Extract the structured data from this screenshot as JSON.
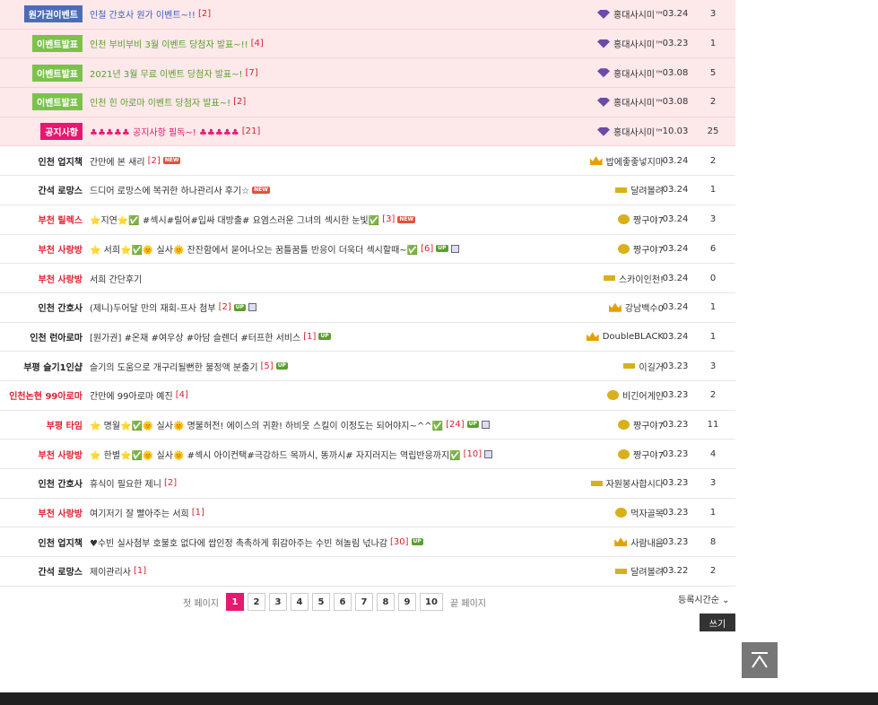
{
  "rows": [
    {
      "cat": "원가권이벤트",
      "badge": "#4d6cb8",
      "title": "인철 간호사 원가 이벤트~!!",
      "tcolor": "#3a62c5",
      "cmt": "[2]",
      "author": "홍대사시미™",
      "lvl": "gem",
      "date": "03.24",
      "hits": "3",
      "hl": true
    },
    {
      "cat": "이벤트발표",
      "badge": "#7cc24a",
      "title": "인천 부비부비 3월 이벤트 당첨자 발표~!!",
      "tcolor": "#5aa02c",
      "cmt": "[4]",
      "author": "홍대사시미™",
      "lvl": "gem",
      "date": "03.23",
      "hits": "1",
      "hl": true
    },
    {
      "cat": "이벤트발표",
      "badge": "#7cc24a",
      "title": "2021년 3월 무료 이벤트 당첨자 발표~!",
      "tcolor": "#5aa02c",
      "cmt": "[7]",
      "author": "홍대사시미™",
      "lvl": "gem",
      "date": "03.08",
      "hits": "5",
      "hl": true
    },
    {
      "cat": "이벤트발표",
      "badge": "#7cc24a",
      "title": "인천 힌 아로마 이벤트 당첨자 발표~!",
      "tcolor": "#5aa02c",
      "cmt": "[2]",
      "author": "홍대사시미™",
      "lvl": "gem",
      "date": "03.08",
      "hits": "2",
      "hl": true
    },
    {
      "cat": "공지사항",
      "badge": "#e6186f",
      "title": "♣♣♣♣♣ 공지사항 필독~! ♣♣♣♣♣",
      "tcolor": "#e6186f",
      "cmt": "[21]",
      "author": "홍대사시미™",
      "lvl": "gem",
      "date": "10.03",
      "hits": "25",
      "hl": true
    },
    {
      "cat": "인천 업지책",
      "ccolor": "#222",
      "title": "간만에 본 새리",
      "cmt": "[2]",
      "icons": [
        "new"
      ],
      "author": "밥에좋좋넣지마",
      "lvl": "crown",
      "date": "03.24",
      "hits": "2"
    },
    {
      "cat": "간석 로망스",
      "ccolor": "#222",
      "title": "드디어 로망스에 복귀한 하나관리사 후기☆",
      "cmt": "",
      "icons": [
        "new"
      ],
      "author": "달려볼려",
      "lvl": "bar",
      "date": "03.24",
      "hits": "1"
    },
    {
      "cat": "부천 릴렉스",
      "ccolor": "#d23",
      "title": "⭐지연⭐✅ #섹시#릴어#입싸 대방출# 요염스러운 그녀의 섹시한 눈빛✅",
      "cmt": "[3]",
      "icons": [
        "new"
      ],
      "author": "짱구야7",
      "lvl": "coin",
      "date": "03.24",
      "hits": "3"
    },
    {
      "cat": "부천 사랑방",
      "ccolor": "#d23",
      "title": "⭐ 서희⭐✅🌞 실사🌞 잔잔함에서 묻어나오는 꿈틀꿈틀 반응이 더욱더 섹시할때~✅",
      "cmt": "[6]",
      "icons": [
        "up",
        "img"
      ],
      "author": "짱구야7",
      "lvl": "coin",
      "date": "03.24",
      "hits": "6"
    },
    {
      "cat": "부천 사랑방",
      "ccolor": "#d23",
      "title": "서희 간단후기",
      "cmt": "",
      "author": "스카이인천!",
      "lvl": "bar",
      "date": "03.24",
      "hits": "0"
    },
    {
      "cat": "인천 간호사",
      "ccolor": "#222",
      "title": "(제니)두어달 만의 재회-프사 첨부",
      "cmt": "[2]",
      "icons": [
        "up",
        "img"
      ],
      "author": "강남백수0",
      "lvl": "crown",
      "date": "03.24",
      "hits": "1"
    },
    {
      "cat": "인천 런아로마",
      "ccolor": "#222",
      "title": "[원가권] #온재 #여우상 #아담 슬렌더 #터프한 서비스",
      "cmt": "[1]",
      "icons": [
        "up"
      ],
      "author": "DoubleBLACK",
      "lvl": "crown",
      "date": "03.24",
      "hits": "1"
    },
    {
      "cat": "부평 슬기1인샵",
      "ccolor": "#222",
      "title": "슬기의 도움으로 개구리될뻔한 불정액 분출기",
      "cmt": "[5]",
      "icons": [
        "up"
      ],
      "author": "이길거",
      "lvl": "bar",
      "date": "03.23",
      "hits": "3"
    },
    {
      "cat": "인천논현 99아로마",
      "ccolor": "#d23",
      "title": "간만에 99아로마 예진",
      "cmt": "[4]",
      "author": "비긴어게인",
      "lvl": "coin",
      "date": "03.23",
      "hits": "2"
    },
    {
      "cat": "부평 타임",
      "ccolor": "#d23",
      "title": "⭐ 명월⭐✅🌞 실사🌞 명불허전! 에이스의 귀환! 하비웃 스킬이 이정도는 되어야지~^^✅",
      "cmt": "[24]",
      "icons": [
        "up",
        "img"
      ],
      "author": "짱구야7",
      "lvl": "coin",
      "date": "03.23",
      "hits": "11"
    },
    {
      "cat": "부천 사랑방",
      "ccolor": "#d23",
      "title": "⭐ 한별⭐✅🌞 실사🌞 #섹시 아이컨택#극강하드 목까시, 똥까시# 자지러지는 역립반응까지✅",
      "cmt": "[10]",
      "icons": [
        "img"
      ],
      "author": "짱구야7",
      "lvl": "coin",
      "date": "03.23",
      "hits": "4"
    },
    {
      "cat": "인천 간호사",
      "ccolor": "#222",
      "title": "휴식이 필요한 제니",
      "cmt": "[2]",
      "author": "자원봉사합시다",
      "lvl": "bar",
      "date": "03.23",
      "hits": "3"
    },
    {
      "cat": "부천 사랑방",
      "ccolor": "#d23",
      "title": "여기저기 잘 빨아주는 서희",
      "cmt": "[1]",
      "author": "먹자골목",
      "lvl": "coin",
      "date": "03.23",
      "hits": "1"
    },
    {
      "cat": "인천 업지책",
      "ccolor": "#222",
      "title": "♥수빈 실사첨부 호불호 없다에 쌉인정 촉촉하게 휘감아주는 수빈 혀놀림 넋나감",
      "cmt": "[30]",
      "icons": [
        "up"
      ],
      "author": "사람내음",
      "lvl": "crown",
      "date": "03.23",
      "hits": "8"
    },
    {
      "cat": "간석 로망스",
      "ccolor": "#222",
      "title": "제이관리사",
      "cmt": "[1]",
      "author": "달려볼려",
      "lvl": "bar",
      "date": "03.22",
      "hits": "2"
    }
  ],
  "pager": {
    "first": "첫 페이지",
    "last": "끝 페이지",
    "pages": [
      "1",
      "2",
      "3",
      "4",
      "5",
      "6",
      "7",
      "8",
      "9",
      "10"
    ],
    "active": "1"
  },
  "sort_label": "등록시간순 ⌄",
  "write_label": "쓰기",
  "icon_labels": {
    "new": "NEW",
    "up": "UP"
  }
}
